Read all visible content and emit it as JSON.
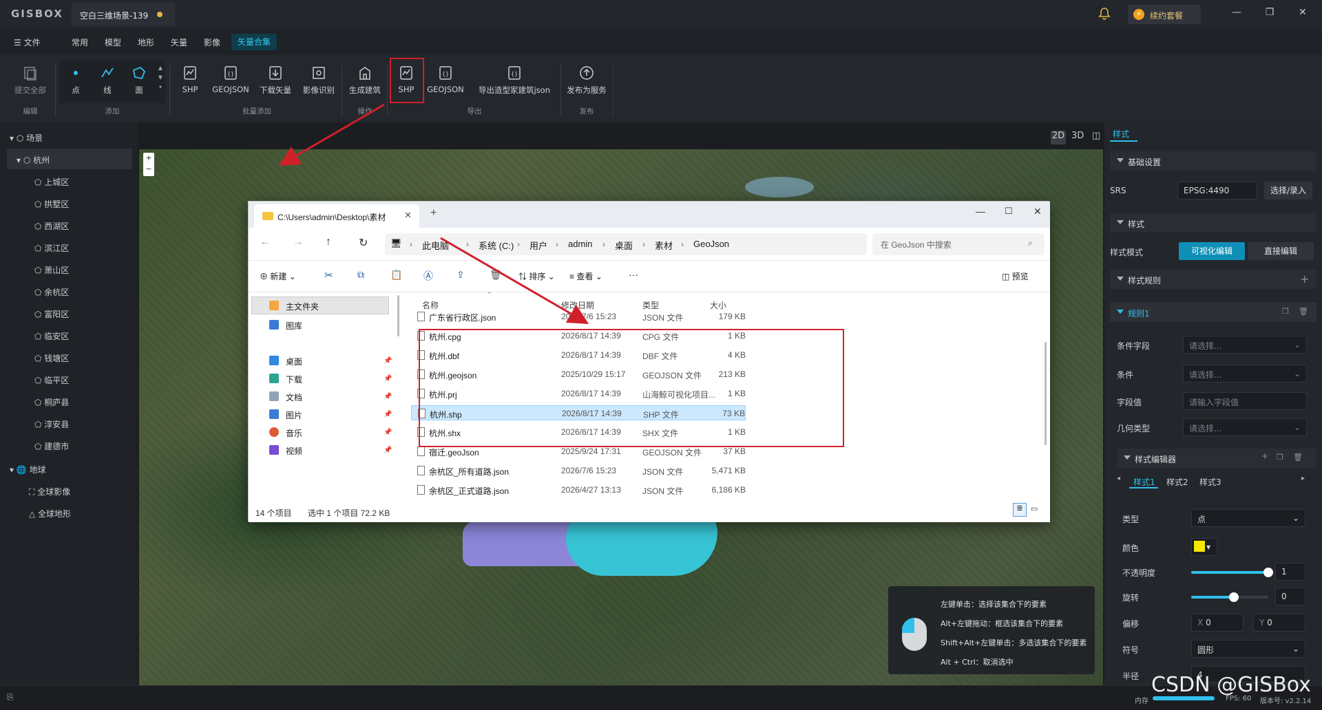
{
  "app": {
    "logo": "GISBOX",
    "tab_title": "空白三维场景-139",
    "renew": "续约套餐"
  },
  "menu": {
    "file": "文件",
    "items": [
      "常用",
      "模型",
      "地形",
      "矢量",
      "影像"
    ],
    "active": "矢量合集"
  },
  "toolbar": {
    "submit_all": "提交全部",
    "group_edit": "编辑",
    "point": "点",
    "line": "线",
    "face": "面",
    "group_add": "添加",
    "shp": "SHP",
    "geojson": "GEOJSON",
    "download_vector": "下载矢量",
    "image_recog": "影像识别",
    "group_batch": "批量添加",
    "gen_building": "生成建筑",
    "group_op": "操作",
    "shp_export": "SHP",
    "geojson_export": "GEOJSON",
    "export_json": "导出造型家建筑json",
    "group_export": "导出",
    "publish": "发布为服务",
    "group_publish": "发布"
  },
  "scene": {
    "title": "场景",
    "city": "杭州",
    "districts": [
      "上城区",
      "拱墅区",
      "西湖区",
      "滨江区",
      "萧山区",
      "余杭区",
      "富阳区",
      "临安区",
      "钱塘区",
      "临平区",
      "桐庐县",
      "淳安县",
      "建德市"
    ],
    "globe": "地球",
    "globe_items": [
      "全球影像",
      "全球地形"
    ]
  },
  "view": {
    "d2": "2D",
    "d3": "3D"
  },
  "right": {
    "tab": "样式",
    "basic": "基础设置",
    "srs_label": "SRS",
    "srs_value": "EPSG:4490",
    "srs_btn": "选择/录入",
    "style": "样式",
    "mode_label": "样式模式",
    "mode_visual": "可视化编辑",
    "mode_direct": "直接编辑",
    "rules": "样式规则",
    "rule1": "规则1",
    "cond_field_label": "条件字段",
    "cond_field_ph": "请选择...",
    "cond_label": "条件",
    "cond_ph": "请选择...",
    "field_value_label": "字段值",
    "field_value_ph": "请输入字段值",
    "geom_label": "几何类型",
    "geom_ph": "请选择...",
    "editor": "样式编辑器",
    "style_tabs": [
      "样式1",
      "样式2",
      "样式3"
    ],
    "type_label": "类型",
    "type_value": "点",
    "color_label": "颜色",
    "color_hex": "#f5e800",
    "opacity_label": "不透明度",
    "opacity_value": "1",
    "opacity": 1.0,
    "rotate_label": "旋转",
    "rotate_value": "0",
    "rotate": 0.55,
    "offset_label": "偏移",
    "offset_x": "X",
    "offset_x_val": "0",
    "offset_y": "Y",
    "offset_y_val": "0",
    "symbol_label": "符号",
    "symbol_value": "圆形",
    "radius_label": "半径",
    "radius_value": "4"
  },
  "tip": {
    "lines": [
      "左键单击：选择该集合下的要素",
      "Alt+左键拖动：框选该集合下的要素",
      "Shift+Alt+左键单击：多选该集合下的要素",
      "Alt + Ctrl：取消选中"
    ]
  },
  "status": {
    "mem": "内存",
    "fps": "FPS: 60",
    "version": "版本号: v2.2.14"
  },
  "explorer": {
    "tab": "C:\\Users\\admin\\Desktop\\素材",
    "crumbs": [
      "此电脑",
      "系统 (C:)",
      "用户",
      "admin",
      "桌面",
      "素材",
      "GeoJson"
    ],
    "search_ph": "在 GeoJson 中搜索",
    "new": "新建",
    "sort": "排序",
    "view": "查看",
    "preview": "预览",
    "nav": [
      "主文件夹",
      "图库",
      "桌面",
      "下载",
      "文档",
      "图片",
      "音乐",
      "视频"
    ],
    "cols": [
      "名称",
      "修改日期",
      "类型",
      "大小"
    ],
    "files": [
      {
        "name": "广东省行政区.json",
        "date": "2026/7/6 15:23",
        "type": "JSON 文件",
        "size": "179 KB"
      },
      {
        "name": "杭州.cpg",
        "date": "2026/8/17 14:39",
        "type": "CPG 文件",
        "size": "1 KB"
      },
      {
        "name": "杭州.dbf",
        "date": "2026/8/17 14:39",
        "type": "DBF 文件",
        "size": "4 KB"
      },
      {
        "name": "杭州.geojson",
        "date": "2025/10/29 15:17",
        "type": "GEOJSON 文件",
        "size": "213 KB"
      },
      {
        "name": "杭州.prj",
        "date": "2026/8/17 14:39",
        "type": "山海鲸可视化项目...",
        "size": "1 KB"
      },
      {
        "name": "杭州.shp",
        "date": "2026/8/17 14:39",
        "type": "SHP 文件",
        "size": "73 KB"
      },
      {
        "name": "杭州.shx",
        "date": "2026/8/17 14:39",
        "type": "SHX 文件",
        "size": "1 KB"
      },
      {
        "name": "宿迁.geoJson",
        "date": "2025/9/24 17:31",
        "type": "GEOJSON 文件",
        "size": "37 KB"
      },
      {
        "name": "余杭区_所有道路.json",
        "date": "2026/7/6 15:23",
        "type": "JSON 文件",
        "size": "5,471 KB"
      },
      {
        "name": "余杭区_正式道路.json",
        "date": "2026/4/27 13:13",
        "type": "JSON 文件",
        "size": "6,186 KB"
      }
    ],
    "status_count": "14 个项目",
    "status_sel": "选中 1 个项目  72.2 KB"
  },
  "watermark": "CSDN @GISBox",
  "colors": {
    "accent": "#2fc0ec",
    "highlight": "#d0202a"
  }
}
